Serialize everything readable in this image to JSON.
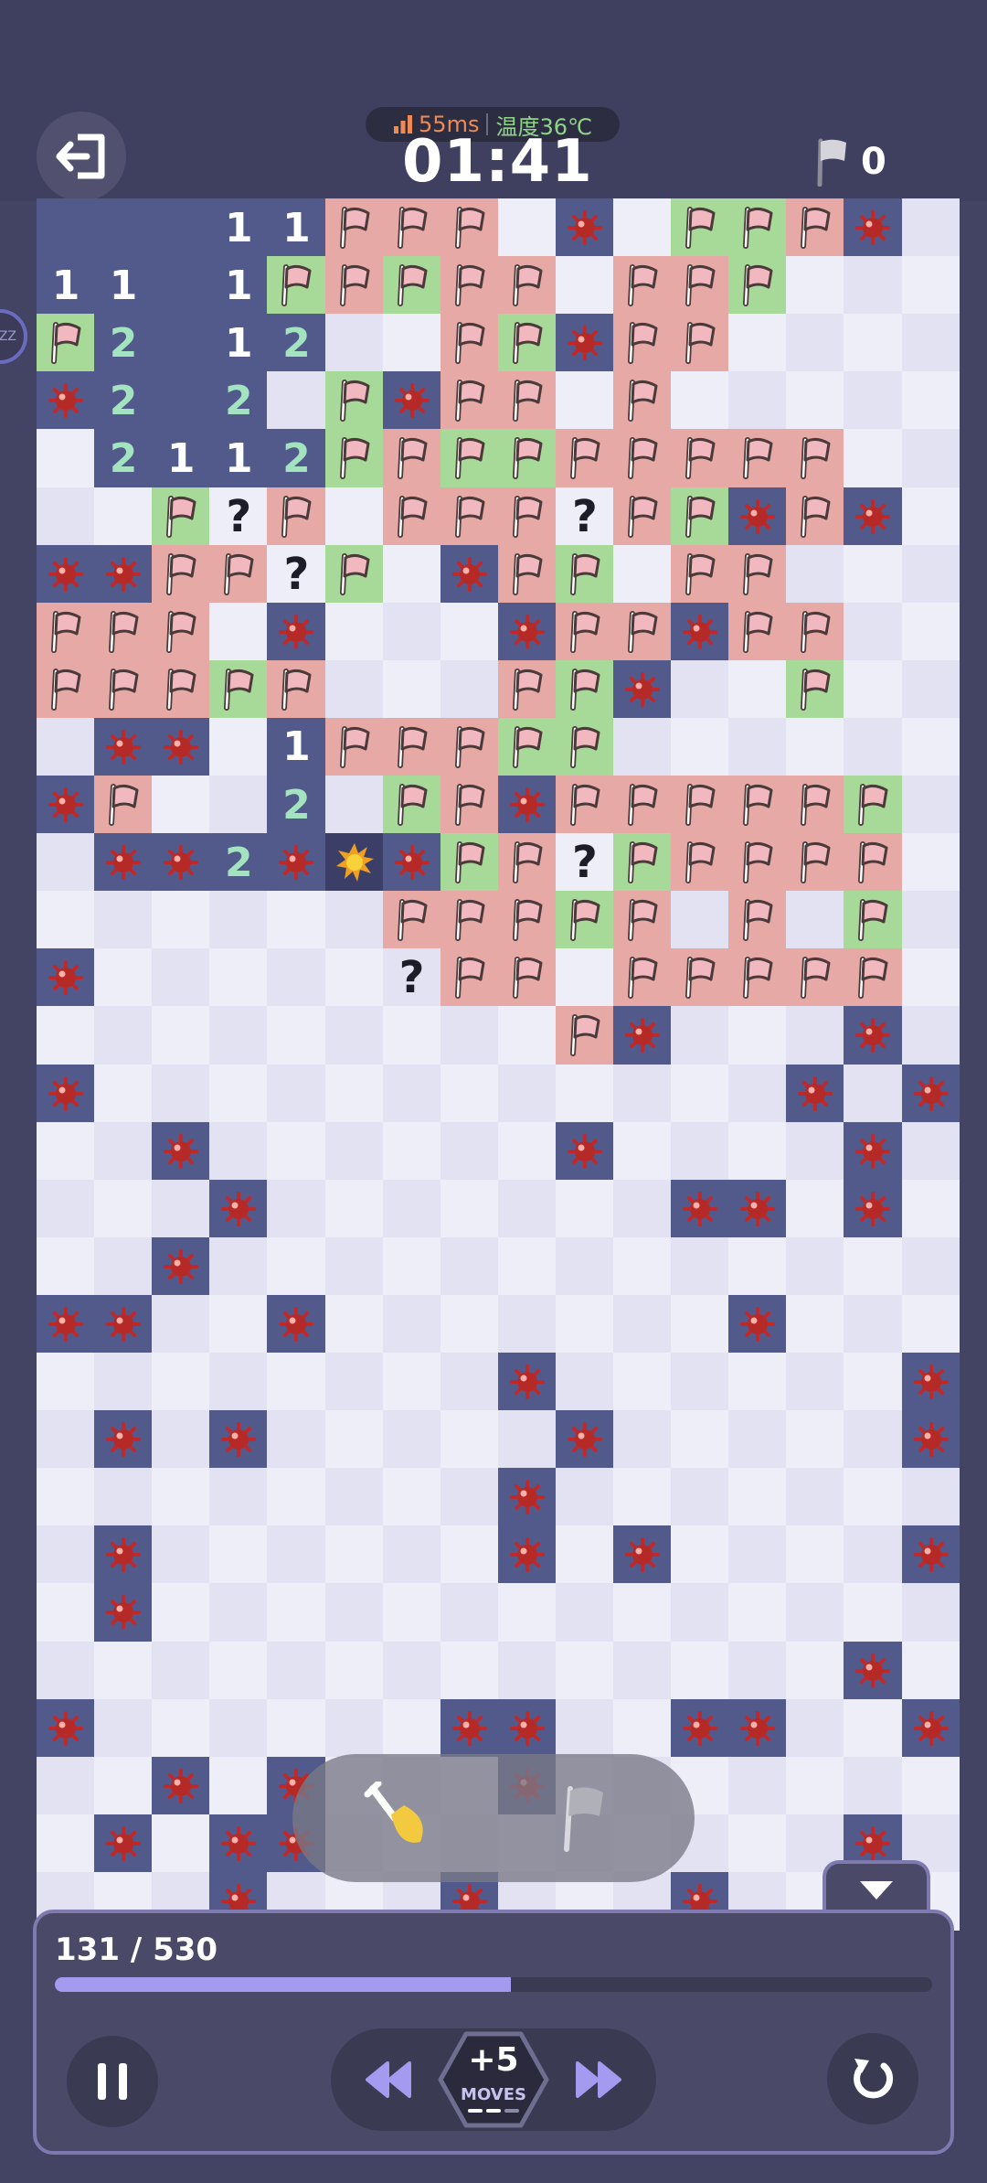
{
  "status": {
    "ping": "55ms",
    "temperature": "温度36℃"
  },
  "timer": "01:41",
  "flags_placed": "0",
  "side_button_label": "ZZ",
  "progress": {
    "text": "131 / 530",
    "fraction": 0.52
  },
  "moves": {
    "plus": "+5",
    "label": "MOVES",
    "charges_filled": 2,
    "charges_total": 3
  },
  "colors": {
    "revealed": "#525a8c",
    "flag_wrong": "#e7a9a5",
    "flag_right": "#a7d998",
    "accent": "#a49bf0",
    "number": "#a3e3c0"
  },
  "tools": [
    "shovel-tool",
    "flag-tool"
  ],
  "board": {
    "cols": 16,
    "legend": "R=revealed, 1/2=number, m=mine, x=exploded, r=pink flag, g=green flag, ?=question, .=unrevealed",
    "rows": [
      "RRR11rrr.m.ggrm.",
      "11R1grgrr.rrg...",
      "g2R12..rgmrr....",
      "m2R2.gmrr.r.....",
      ".2112grggrrrrr..",
      "..g?r.rrr?rgmrm.",
      "mmrr?g.mrg.rr...",
      "rrr.m...mrrmrr..",
      "rrrgr...rgm..g..",
      ".mm.1rrrgg......",
      "mr..2.grmrrrrrg.",
      ".mm2mxmgr?grrrr.",
      "......rrrgr.r.g.",
      "m.....?rr.rrrrr.",
      ".........rm...m.",
      "m............m.m",
      "..m......m....m.",
      "...m.......mm.m.",
      "..m.............",
      "mm..m.......m...",
      "........m......m",
      ".m.m.....m.....m",
      "........m.......",
      ".m......m.m....m",
      ".m..............",
      "..............m.",
      "m......mm..mm..m",
      "..m.m...m.......",
      ".m.mm.........m.",
      "...m...m...m..m."
    ]
  }
}
